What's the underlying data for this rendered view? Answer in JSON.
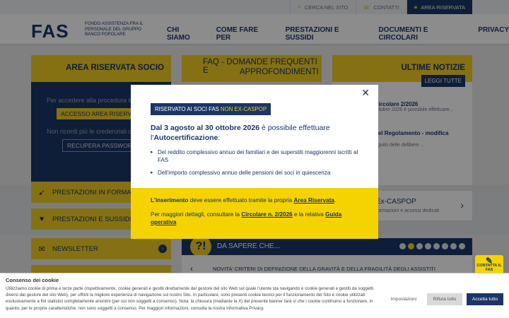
{
  "topbar": {
    "search_label": "CERCA NEL SITO",
    "contacts_label": "CONTATTI",
    "reserved_label": "AREA RISERVATA"
  },
  "header": {
    "logo": "FAS",
    "logo_sub": "FONDO ASSISTENZA FRA IL PERSONALE DEL GRUPPO BANCO POPOLARE",
    "nav": [
      "CHI SIAMO",
      "COME FARE PER",
      "PRESTAZIONI E SUSSIDI",
      "DOCUMENTI E CIRCOLARI",
      "PRIVACY"
    ]
  },
  "panels": {
    "area_title": "AREA RISERVATA SOCIO",
    "area_text_1": "Per accedere alla procedura te",
    "area_button": "ACCESSO AREA RISERVA",
    "area_text_2": "Non ricordi più le credenziali di",
    "area_recover": "RECUPERA PASSWORD",
    "faq_title_1": "FAQ - DOMANDE FREQUENTI E",
    "faq_title_2": "APPROFONDIMENTI",
    "news_title": "ULTIME NOTIZIE",
    "news_button": "LEGGI TUTTE",
    "news_1_title": "Circolare 2/2026",
    "news_1_text": "ottobre 2026 è possibile effettuare...",
    "news_2_title": "del Regolamento - modifica",
    "news_2_text": "eguito delle delibere ...",
    "excaspop_title": "Ex-CASPOP",
    "excaspop_text": "formazioni e accessi dedicati",
    "left_rows": [
      "PRESTAZIONI IN FORMA DIR",
      "PRESTAZIONI E SUSSIDI",
      "NEWSLETTER"
    ],
    "sapere_title": "DA SAPERE CHE...",
    "ticker": "NOVITA' CRITERI DI DEFINIZIONE DELLA GRAVITÀ E DELLA FRAGILITÀ DEGLI ASSISTITI"
  },
  "modal": {
    "tag_prefix": "RISERVATO AI SOCI FAS",
    "tag_highlight": "NON EX-CASPOP",
    "head_bold_1": "Dal 3 agosto al 30 ottobre 2026",
    "head_mid": " è possibile effettuare l'",
    "head_bold_2": "Autocertificazione",
    "head_end": ":",
    "items": [
      "Del reddito complessivo annuo dei familiari e dei superstiti maggiorenni iscritti al FAS",
      "Dell'importo complessivo annuo delle pensioni dei soci in quiescenza"
    ],
    "p1_bold": "L'inserimento",
    "p1_mid": " deve essere effettuato tramite la propria ",
    "p1_link": "Area Riservata",
    "p1_end": ".",
    "p2_start": "Per maggiori dettagli, consultare la ",
    "p2_link1": "Circolare n. 2/2026",
    "p2_mid": " e la relativa ",
    "p2_link2": "Guida operativa"
  },
  "contact_button": "CONTATTA IL FAS",
  "cookie": {
    "title": "Consenso dei cookie",
    "text": "Utilizziamo cookie di prima e terze parte (rispettivamente, cookie generati e gestiti direttamente dal gestore del sito Web sul quale l'utente sta navigando e cookie generati e gestiti da soggetti diversi dal gestore del sito Web), per offrirti la migliore esperienza di navigazione sul nostro Sito. In particolare, sono presenti cookie tecnici per il funzionamento del Sito e cookie utilizzati esclusivamente a fini statistici completamente anonimi (per cui non soggetti a consenso). Nota: la chiusura (mediante la X) del presente banner farà sì che i cookie continuino a funzionare, in quanto, per le proprie caratteristiche, non sono soggetti a consenso. Per maggiori informazioni, consulta la nostra Informativa Privacy.",
    "settings": "Impostazioni",
    "reject": "Rifiuta tutto",
    "accept": "Accetta tutto"
  }
}
